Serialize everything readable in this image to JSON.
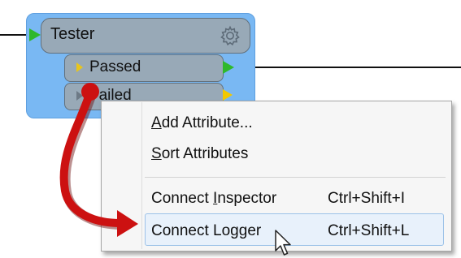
{
  "transformer": {
    "title": "Tester",
    "settings_icon": "gear-icon",
    "ports": {
      "passed": "Passed",
      "failed": "Failed"
    }
  },
  "context_menu": {
    "items": [
      {
        "label_underlined": "A",
        "label_rest": "dd Attribute...",
        "shortcut": ""
      },
      {
        "label_underlined": "S",
        "label_rest": "ort Attributes",
        "shortcut": ""
      },
      {
        "label_prefix": "Connect ",
        "label_underlined": "I",
        "label_rest": "nspector",
        "shortcut": "Ctrl+Shift+I"
      },
      {
        "label": "Connect Logger",
        "shortcut": "Ctrl+Shift+L"
      }
    ],
    "highlighted_item": "Connect Logger"
  },
  "colors": {
    "transformer_bg": "#79b8f3",
    "port_bg": "#98a9b7",
    "green_port": "#2fb82c",
    "yellow_port": "#f2c800",
    "annotation_arrow": "#cc1111",
    "menu_highlight": "#e8f1fb"
  }
}
